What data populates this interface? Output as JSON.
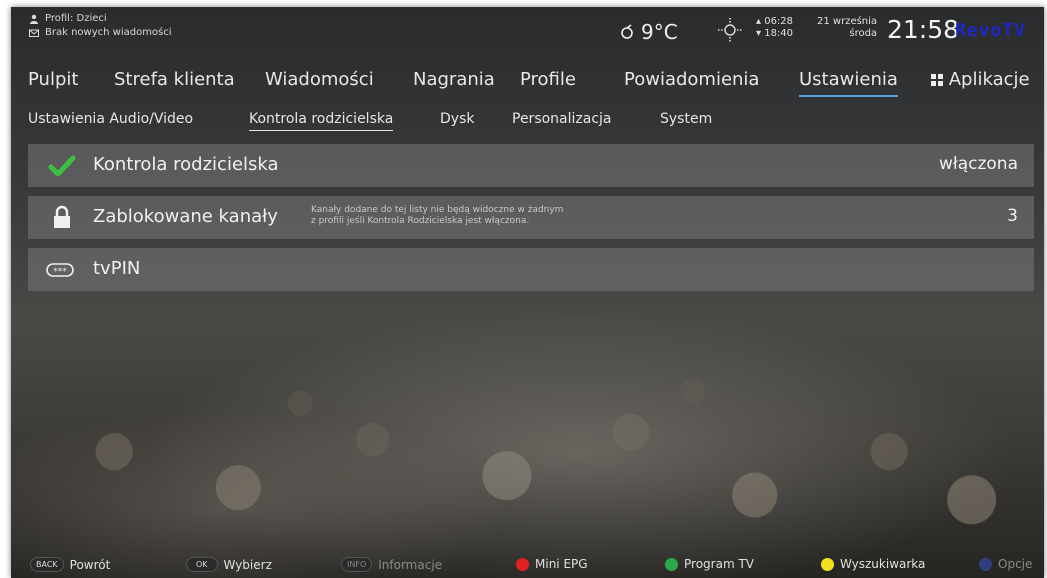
{
  "status": {
    "profile": "Profil: Dzieci",
    "messages": "Brak nowych wiadomości",
    "temperature": "9°C",
    "sunrise": "06:28",
    "sunset": "18:40",
    "date_line1": "21 września",
    "date_line2": "środa",
    "time": "21:58",
    "logo": "RevoTV"
  },
  "main_nav": [
    {
      "label": "Pulpit"
    },
    {
      "label": "Strefa klienta"
    },
    {
      "label": "Wiadomości"
    },
    {
      "label": "Nagrania"
    },
    {
      "label": "Profile"
    },
    {
      "label": "Powiadomienia"
    },
    {
      "label": "Ustawienia",
      "active": true
    },
    {
      "label": "Aplikacje"
    }
  ],
  "sub_nav": [
    {
      "label": "Ustawienia Audio/Video"
    },
    {
      "label": "Kontrola rodzicielska",
      "active": true
    },
    {
      "label": "Dysk"
    },
    {
      "label": "Personalizacja"
    },
    {
      "label": "System"
    }
  ],
  "rows": [
    {
      "label": "Kontrola rodzicielska",
      "value": "włączona",
      "icon": "checkmark-icon"
    },
    {
      "label": "Zablokowane kanały",
      "value": "3",
      "icon": "lock-icon",
      "desc_line1": "Kanały dodane do tej listy nie będą widoczne w żadnym",
      "desc_line2": "z profili jeśli Kontrola Rodzicielska jest włączona."
    },
    {
      "label": "tvPIN",
      "icon": "pin-icon",
      "pin_glyph": "***"
    }
  ],
  "bottom_bar": {
    "back_key": "BACK",
    "back": "Powrót",
    "ok_key": "OK",
    "select": "Wybierz",
    "info_key": "INFO",
    "info": "Informacje",
    "red": "Mini EPG",
    "green": "Program TV",
    "yellow": "Wyszukiwarka",
    "blue": "Opcje"
  },
  "colors": {
    "active_underline": "#4ea3e6",
    "check_green": "#3fbf3f",
    "red_button": "#e02020",
    "green_button": "#2aa84a",
    "yellow_button": "#f0e020",
    "blue_button": "#3050c0",
    "logo": "#1d28c7"
  }
}
